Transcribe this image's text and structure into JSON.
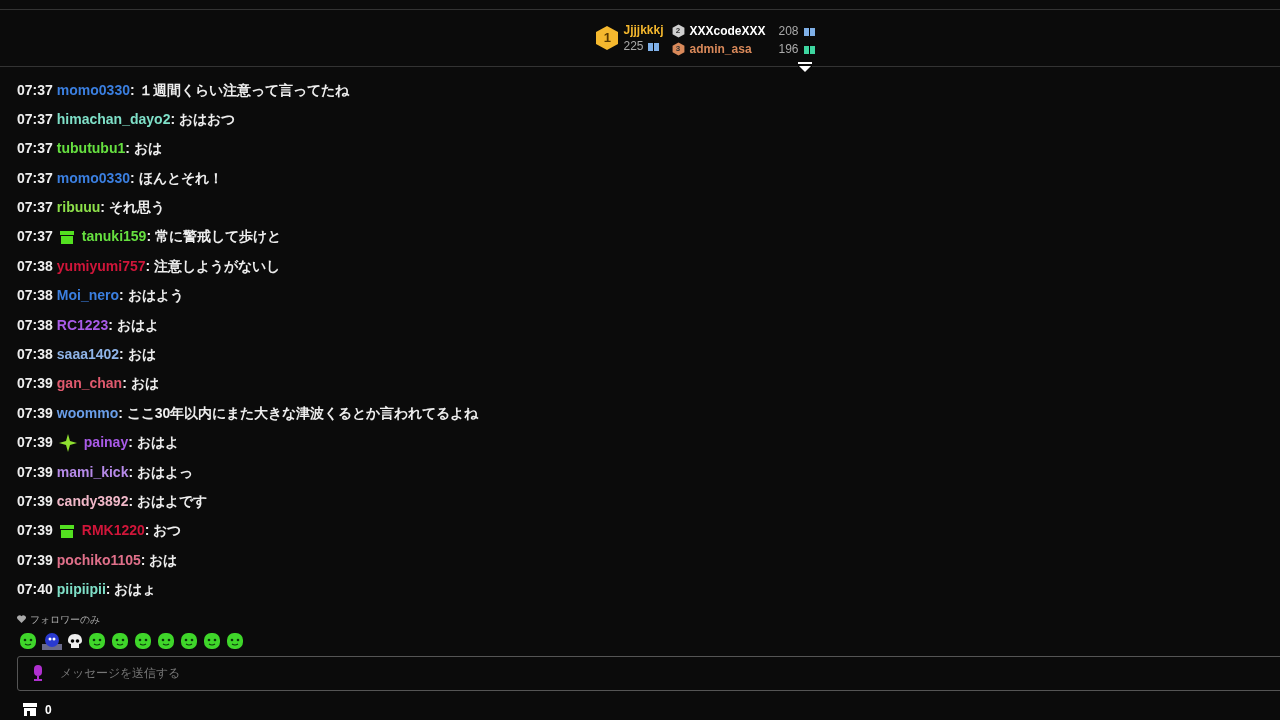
{
  "leaderboard": [
    {
      "rank": "1",
      "name": "Jjjjkkkj",
      "count": "225",
      "color": "#f5b82e"
    },
    {
      "rank": "2",
      "name": "XXXcodeXXX",
      "count": "208",
      "color": "#cfcfcf"
    },
    {
      "rank": "3",
      "name": "admin_asa",
      "count": "196",
      "color": "#d9895a"
    }
  ],
  "messages": [
    {
      "kind": "plain",
      "time": "07:37",
      "user": "momo0330",
      "color": "#3b7fe0",
      "text": ": １週間くらい注意って言ってたね"
    },
    {
      "kind": "plain",
      "time": "07:37",
      "user": "himachan_dayo2",
      "color": "#7fe0c8",
      "text": ": おはおつ"
    },
    {
      "kind": "plain",
      "time": "07:37",
      "user": "tubutubu1",
      "color": "#66e040",
      "text": ": おは"
    },
    {
      "kind": "plain",
      "time": "07:37",
      "user": "momo0330",
      "color": "#3b7fe0",
      "text": ": ほんとそれ！"
    },
    {
      "kind": "plain",
      "time": "07:37",
      "user": "ribuuu",
      "color": "#8de04a",
      "text": ": それ思う"
    },
    {
      "kind": "gift",
      "time": "07:37",
      "user": "tanuki159",
      "color": "#66e040",
      "text": ": 常に警戒して歩けと"
    },
    {
      "kind": "plain",
      "time": "07:38",
      "user": "yumiyumi757",
      "color": "#d0163a",
      "text": ": 注意しようがないし"
    },
    {
      "kind": "plain",
      "time": "07:38",
      "user": "Moi_nero",
      "color": "#3b7fe0",
      "text": ": おはよう"
    },
    {
      "kind": "plain",
      "time": "07:38",
      "user": "RC1223",
      "color": "#a95be8",
      "text": ": おはよ"
    },
    {
      "kind": "plain",
      "time": "07:38",
      "user": "saaa1402",
      "color": "#8fb4e8",
      "text": ": おは"
    },
    {
      "kind": "plain",
      "time": "07:39",
      "user": "gan_chan",
      "color": "#e05a6e",
      "text": ": おは"
    },
    {
      "kind": "plain",
      "time": "07:39",
      "user": "woommo",
      "color": "#6a9ee8",
      "text": ": ここ30年以内にまた大きな津波くるとか言われてるよね"
    },
    {
      "kind": "sparkle",
      "time": "07:39",
      "user": "painay",
      "color": "#a95be8",
      "text": ": おはよ"
    },
    {
      "kind": "plain",
      "time": "07:39",
      "user": "mami_kick",
      "color": "#b68ae8",
      "text": ": おはよっ"
    },
    {
      "kind": "plain",
      "time": "07:39",
      "user": "candy3892",
      "color": "#f0b8c8",
      "text": ": おはよです"
    },
    {
      "kind": "gift",
      "time": "07:39",
      "user": "RMK1220",
      "color": "#d0163a",
      "text": ": おつ"
    },
    {
      "kind": "plain",
      "time": "07:39",
      "user": "pochiko1105",
      "color": "#e0708a",
      "text": ": おは"
    },
    {
      "kind": "plain",
      "time": "07:40",
      "user": "piipiipii",
      "color": "#7fe0c8",
      "text": ": おはょ"
    }
  ],
  "chat_mode": "フォロワーのみ",
  "input": {
    "placeholder": "メッセージを送信する"
  },
  "points": "0"
}
